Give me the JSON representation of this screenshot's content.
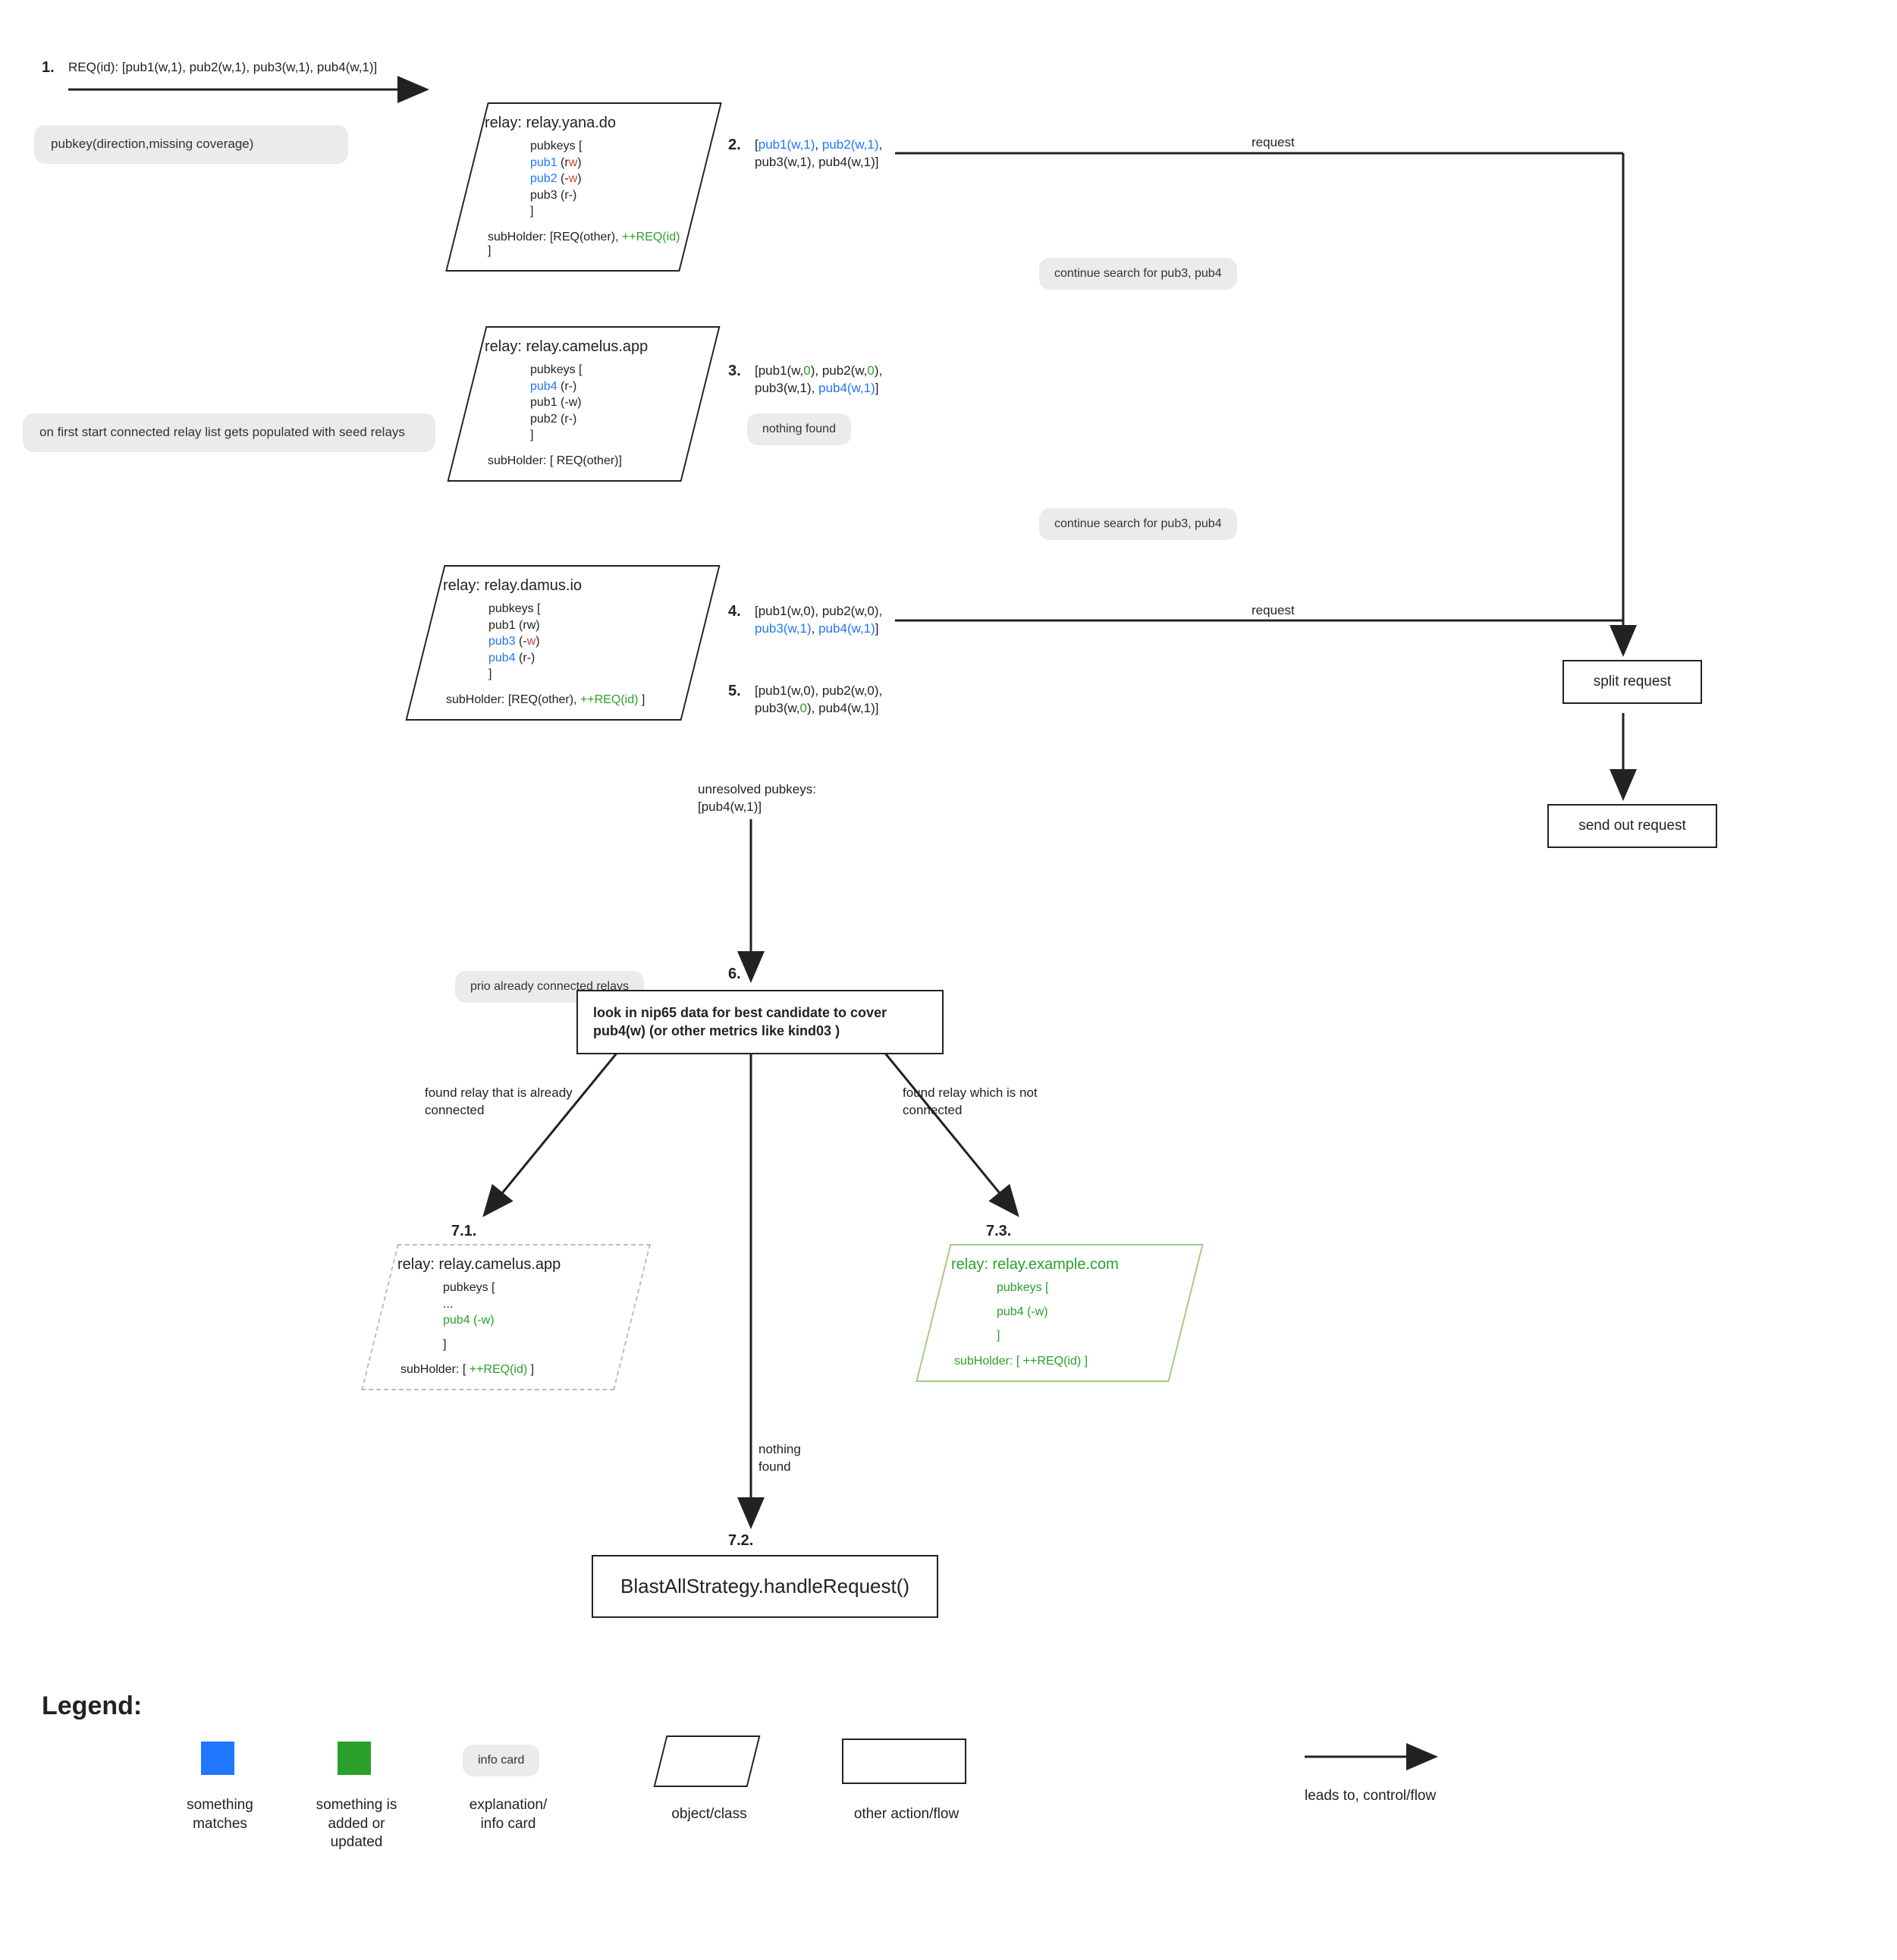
{
  "step1": {
    "num": "1.",
    "text": "REQ(id): [pub1(w,1), pub2(w,1), pub3(w,1), pub4(w,1)]"
  },
  "legend_pubkey_card": "pubkey(direction,missing coverage)",
  "seed_card": "on first start connected relay list gets populated with seed relays",
  "relay_yana": {
    "title": "relay: relay.yana.do",
    "l1": "pubkeys [",
    "l2a": "pub1",
    "l2b": " (",
    "l2c": "r",
    "l2d": "w",
    "l2e": ")",
    "l3a": "pub2",
    "l3b": " (-",
    "l3c": "w",
    "l3d": ")",
    "l4": "pub3 (r-)",
    "l5": "]",
    "sub_a": "subHolder: [REQ(other), ",
    "sub_b": "++REQ(id)",
    "sub_c": " ]"
  },
  "step2": {
    "num": "2.",
    "a": "[",
    "b": "pub1(w,1)",
    "c": ", ",
    "d": "pub2(w,1)",
    "e": ",",
    "f": "pub3(w,1), pub4(w,1)]"
  },
  "request_label_top": "request",
  "continue1": "continue search for pub3, pub4",
  "relay_camelus": {
    "title": "relay: relay.camelus.app",
    "l1": "pubkeys [",
    "l2a": "pub4",
    "l2b": " (r-)",
    "l3": "pub1 (-w)",
    "l4": "pub2 (r-)",
    "l5": "]",
    "sub": "subHolder: [ REQ(other)]"
  },
  "step3": {
    "num": "3.",
    "a": "[pub1(w,",
    "a0": "0",
    "b": "), pub2(w,",
    "b0": "0",
    "c": "),",
    "d": "pub3(w,1), ",
    "e": "pub4(w,1)",
    "f": "]"
  },
  "nothing_found": "nothing found",
  "continue2": "continue search for pub3, pub4",
  "relay_damus": {
    "title": "relay: relay.damus.io",
    "l1": "pubkeys [",
    "l2": "pub1 (rw)",
    "l3a": "pub3",
    "l3b": " (-",
    "l3c": "w",
    "l3d": ")",
    "l4a": "pub4",
    "l4b": " (r-)",
    "l5": "]",
    "sub_a": "subHolder: [REQ(other), ",
    "sub_b": "++REQ(id)",
    "sub_c": " ]"
  },
  "step4": {
    "num": "4.",
    "a": "[pub1(w,0), pub2(w,0),",
    "b1": "pub3(w,1)",
    "c": ", ",
    "b2": "pub4(w,1)",
    "d": "]"
  },
  "request_label_4": "request",
  "step5": {
    "num": "5.",
    "a": "[pub1(w,0), pub2(w,0),",
    "b": "pub3(w,",
    "b0": "0",
    "c": "), pub4(w,1)]"
  },
  "split_request": "split request",
  "send_out_request": "send out request",
  "unresolved": {
    "a": "unresolved pubkeys:",
    "b": "[pub4(w,1)]"
  },
  "prio_card": "prio already connected relays",
  "step6": {
    "num": "6.",
    "text": "look in nip65 data for best candidate to cover pub4(w) (or other metrics like kind03 )"
  },
  "branch_left": "found relay that is already connected",
  "branch_mid": "nothing found",
  "branch_right": "found relay which is not connected",
  "step71": {
    "num": "7.1.",
    "title": "relay: relay.camelus.app",
    "l1": "pubkeys [",
    "l2": "...",
    "l3": "pub4 (-w)",
    "l4": "]",
    "sub_a": "subHolder: [ ",
    "sub_b": "++REQ(id)",
    "sub_c": " ]"
  },
  "step72": {
    "num": "7.2.",
    "text": "BlastAllStrategy.handleRequest()"
  },
  "step73": {
    "num": "7.3.",
    "title": "relay: relay.example.com",
    "l1": "pubkeys [",
    "l2": "pub4 (-w)",
    "l3": "]",
    "sub": "subHolder: [ ++REQ(id) ]"
  },
  "legend": {
    "title": "Legend:",
    "blue": "something matches",
    "green": "something is added or updated",
    "info": "info card",
    "info_label": "explanation/ info card",
    "object": "object/class",
    "action": "other action/flow",
    "arrow": "leads to, control/flow"
  }
}
